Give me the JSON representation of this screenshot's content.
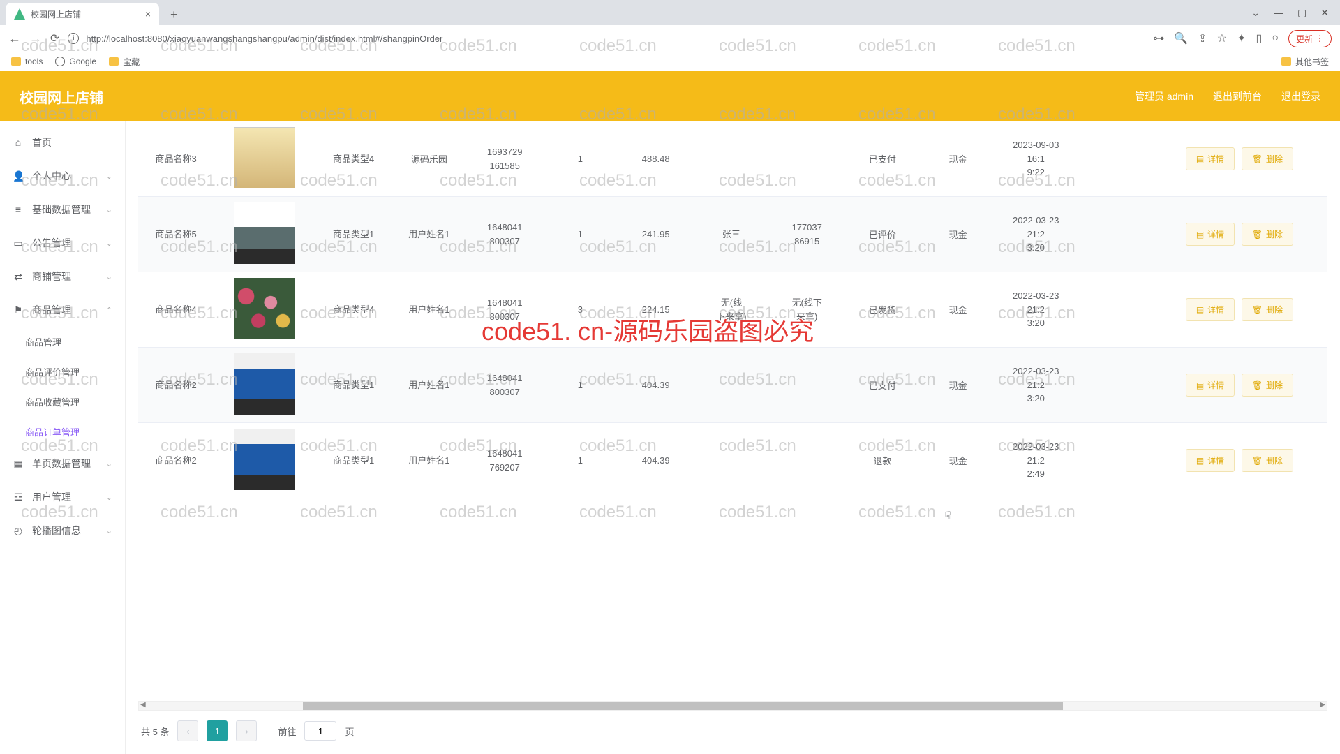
{
  "browser": {
    "tab_title": "校园网上店铺",
    "url": "http://localhost:8080/xiaoyuanwangshangshangpu/admin/dist/index.html#/shangpinOrder",
    "bookmarks": [
      "tools",
      "Google",
      "宝藏"
    ],
    "other_bookmarks": "其他书签",
    "update_label": "更新"
  },
  "header": {
    "title": "校园网上店铺",
    "admin_label": "管理员 admin",
    "exit_front": "退出到前台",
    "logout": "退出登录"
  },
  "sidebar": {
    "items": [
      {
        "icon": "⌂",
        "label": "首页"
      },
      {
        "icon": "👤",
        "label": "个人中心",
        "chev": true
      },
      {
        "icon": "≡",
        "label": "基础数据管理",
        "chev": true
      },
      {
        "icon": "▭",
        "label": "公告管理",
        "chev": true
      },
      {
        "icon": "⇄",
        "label": "商铺管理",
        "chev": true
      },
      {
        "icon": "⚑",
        "label": "商品管理",
        "chev": true
      }
    ],
    "product_submenu": [
      "商品管理",
      "商品评价管理",
      "商品收藏管理",
      "商品订单管理"
    ],
    "active_sub": "商品订单管理",
    "tail_items": [
      {
        "icon": "▦",
        "label": "单页数据管理",
        "chev": true
      },
      {
        "icon": "☲",
        "label": "用户管理",
        "chev": true
      },
      {
        "icon": "◴",
        "label": "轮播图信息",
        "chev": true
      }
    ]
  },
  "table": {
    "rows": [
      {
        "name": "商品名称3",
        "thumb": "phone",
        "type": "商品类型4",
        "user_detail": "源码乐园",
        "order_no": "1693729161585",
        "qty": "1",
        "price": "488.48",
        "addr": "",
        "express": "",
        "status": "已支付",
        "pay": "现金",
        "time": "2023-09-03 16:19:22"
      },
      {
        "name": "商品名称5",
        "thumb": "person1",
        "type": "商品类型1",
        "user": "用户姓名1",
        "order_no": "1648041800307",
        "qty": "1",
        "price": "241.95",
        "addr": "张三",
        "express": "17703786915",
        "status": "已评价",
        "pay": "现金",
        "time": "2022-03-23 21:23:20"
      },
      {
        "name": "商品名称4",
        "thumb": "flowers",
        "type": "商品类型4",
        "user": "用户姓名1",
        "order_no": "1648041800307",
        "qty": "3",
        "price": "224.15",
        "addr": "无(线下来拿)",
        "express": "无(线下来拿)",
        "status": "已发货",
        "pay": "现金",
        "time": "2022-03-23 21:23:20"
      },
      {
        "name": "商品名称2",
        "thumb": "person2",
        "type": "商品类型1",
        "user": "用户姓名1",
        "order_no": "1648041800307",
        "qty": "1",
        "price": "404.39",
        "addr": "",
        "express": "",
        "status": "已支付",
        "pay": "现金",
        "time": "2022-03-23 21:23:20"
      },
      {
        "name": "商品名称2",
        "thumb": "person2",
        "type": "商品类型1",
        "user": "用户姓名1",
        "order_no": "1648041769207",
        "qty": "1",
        "price": "404.39",
        "addr": "",
        "express": "",
        "status": "退款",
        "pay": "现金",
        "time": "2022-03-23 21:22:49"
      }
    ],
    "actions": {
      "detail": "详情",
      "delete": "删除"
    }
  },
  "pagination": {
    "total_label": "共 5 条",
    "current": "1",
    "goto_prefix": "前往",
    "goto_suffix": "页",
    "goto_value": "1"
  },
  "watermark": {
    "text": "code51.cn",
    "big_text": "code51. cn-源码乐园盗图必究"
  }
}
